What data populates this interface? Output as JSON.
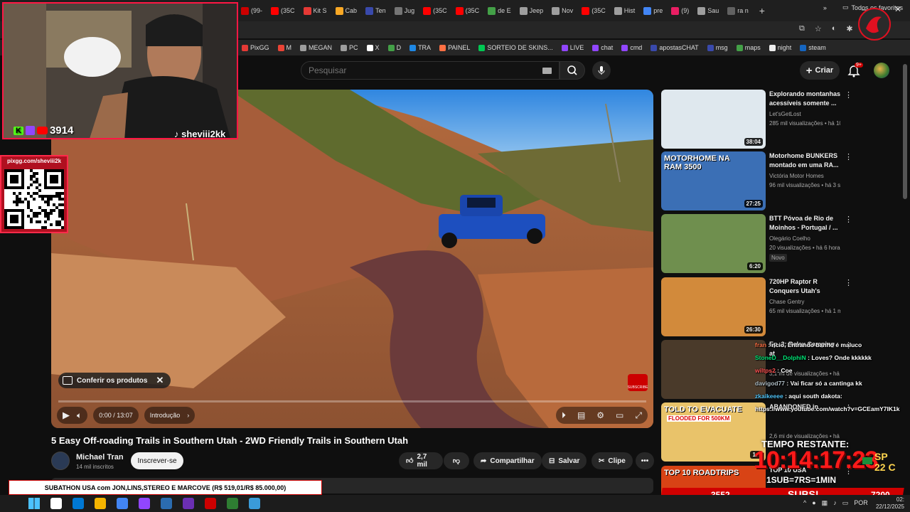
{
  "browser": {
    "tabs": [
      {
        "label": "(99-",
        "color": "#cc0000"
      },
      {
        "label": "(35C",
        "color": "#ff0000"
      },
      {
        "label": "Kit S",
        "color": "#e53935"
      },
      {
        "label": "Cab",
        "color": "#f9a825"
      },
      {
        "label": "Ten",
        "color": "#3949ab"
      },
      {
        "label": "Jug",
        "color": "#757575"
      },
      {
        "label": "(35C",
        "color": "#ff0000"
      },
      {
        "label": "(35C",
        "color": "#ff0000"
      },
      {
        "label": "de E",
        "color": "#43a047"
      },
      {
        "label": "Jeep",
        "color": "#9e9e9e"
      },
      {
        "label": "Nov",
        "color": "#9e9e9e"
      },
      {
        "label": "(35C",
        "color": "#ff0000"
      },
      {
        "label": "Hist",
        "color": "#9e9e9e"
      },
      {
        "label": "pre",
        "color": "#4285f4"
      },
      {
        "label": "(9)",
        "color": "#e91e63"
      },
      {
        "label": "Sau",
        "color": "#9e9e9e"
      },
      {
        "label": "ra n",
        "color": "#616161"
      }
    ],
    "tab_add": "+",
    "win_minimize": "—",
    "win_close": "✕",
    "bookmarks": [
      {
        "label": "PixGG",
        "color": "#e53935"
      },
      {
        "label": "M",
        "color": "#ea4335"
      },
      {
        "label": "MEGAN",
        "color": "#9e9e9e"
      },
      {
        "label": "PC",
        "color": "#9e9e9e"
      },
      {
        "label": "X",
        "color": "#ffffff"
      },
      {
        "label": "D",
        "color": "#43a047"
      },
      {
        "label": "TRA",
        "color": "#1e88e5"
      },
      {
        "label": "PAINEL",
        "color": "#ff7043"
      },
      {
        "label": "SORTEIO DE SKINS...",
        "color": "#00c853"
      },
      {
        "label": "LIVE",
        "color": "#9146ff"
      },
      {
        "label": "chat",
        "color": "#9146ff"
      },
      {
        "label": "cmd",
        "color": "#9146ff"
      },
      {
        "label": "apostasCHAT",
        "color": "#3949ab"
      },
      {
        "label": "msg",
        "color": "#3949ab"
      },
      {
        "label": "maps",
        "color": "#43a047"
      },
      {
        "label": "night",
        "color": "#eeeeee"
      },
      {
        "label": "steam",
        "color": "#1565c0"
      }
    ],
    "bookmarks_more": "»",
    "all_favorites": "Todos os favoritos"
  },
  "youtube": {
    "search_placeholder": "Pesquisar",
    "create_label": "Criar",
    "notif_badge": "9+"
  },
  "player": {
    "products_label": "Conferir os produtos",
    "time": "0:00 / 13:07",
    "chapter": "Introdução",
    "progress_fraction": 0.0,
    "subscribe_watermark": "SUBSCRIBE"
  },
  "video": {
    "title": "5 Easy Off-roading Trails in Southern Utah - 2WD Friendly Trails in Southern Utah",
    "channel": "Michael Tran",
    "subscribers": "14 mil inscritos",
    "subscribe_label": "Inscrever-se",
    "likes": "2,7 mil",
    "share_label": "Compartilhar",
    "save_label": "Salvar",
    "clip_label": "Clipe",
    "more_label": "•••"
  },
  "recommendations": [
    {
      "title": "Explorando montanhas acessíveis somente ...",
      "channel": "Let'sGetLost",
      "meta": "285 mil visualizações • há 10 ...",
      "duration": "38:04",
      "new": "",
      "thumb": "#dfe8ee"
    },
    {
      "title": "Motorhome BUNKERS montado em uma RA...",
      "channel": "Victória Motor Homes",
      "meta": "96 mil visualizações • há 3 se...",
      "duration": "27:25",
      "new": "",
      "thumb": "#3b6fb5",
      "thumb_text": "MOTORHOME NA RAM 3500"
    },
    {
      "title": "BTT Póvoa de Rio de Moinhos - Portugal / ...",
      "channel": "Olegário Coelho",
      "meta": "20 visualizações • há 6 horas",
      "duration": "6:20",
      "new": "Novo",
      "thumb": "#6f8f4e"
    },
    {
      "title": "720HP Raptor R Conquers Utah's Most...",
      "channel": "Chase Gentry",
      "meta": "65 mil visualizações • há 1 mês",
      "duration": "26:30",
      "new": "",
      "thumb": "#d28a3b"
    },
    {
      "title": "Ep. 2: Relax Camping at",
      "channel": "",
      "meta": "3,1 mi de visualizações • há 3 ...",
      "duration": "",
      "new": "",
      "thumb": "#4a3a2a"
    },
    {
      "title": "ABANDONED in",
      "channel": "",
      "meta": "2,6 mi de visualizações • há 6 ...",
      "duration": "1:2",
      "new": "",
      "thumb": "#e9c36a",
      "thumb_text": "TOLD TO EVACUATE",
      "thumb_sub": "FLOODED FOR 500KM"
    },
    {
      "title": "TOP 10 USA",
      "channel": "",
      "meta": "",
      "duration": "",
      "new": "",
      "thumb": "#d84315",
      "thumb_text": "TOP 10 ROADTRIPS"
    }
  ],
  "overlay": {
    "cam_count": "3914",
    "cam_handle": "sheviii2kk",
    "qr_label": "pixgg.com/sheviii2k",
    "chat": [
      {
        "user": "fran",
        "color": "#ff7043",
        "text": "ncio, Entrando banho é maluco"
      },
      {
        "user": "StoneD__DolphiN",
        "color": "#00e676",
        "text": "Loves? Onde kkkkkk"
      },
      {
        "user": "wiltps2",
        "color": "#ff5252",
        "text": "Coe"
      },
      {
        "user": "davigod77",
        "color": "#b0bec5",
        "text": "Vai ficar só a cantinga kk"
      },
      {
        "user": "zkaikeeee",
        "color": "#4fc3f7",
        "text": "aqui south dakota:"
      },
      {
        "user": "",
        "color": "#ffffff",
        "text": "https://www.youtube.com/watch?v=GCEamY7IK1k"
      }
    ],
    "timer_label": "TEMPO RESTANTE:",
    "timer": "10:14:17:23",
    "weather_city": "SP",
    "weather_temp": "22 C",
    "sub_goal": "1SUB=7RS=1MIN",
    "count_left": "3552",
    "subs_word": "SUBS!",
    "count_right": "7200",
    "ticker": "SUBATHON USA com JON,LINS,STEREO E MARCOVE (R$ 519,01/R$ 85.000,00)"
  },
  "taskbar": {
    "lang": "POR",
    "time": "02:",
    "date": "22/12/2025",
    "icons": [
      "#ffffff",
      "#0078d4",
      "#f4b400",
      "#4285f4",
      "#9146ff",
      "#2b6cb0",
      "#6b2fb3",
      "#cc0000",
      "#2e7d32",
      "#3a9bd9"
    ]
  },
  "colors": {
    "accent": "#ff0000",
    "cam_border": "#ff1744",
    "timer": "#ff1a1a"
  }
}
